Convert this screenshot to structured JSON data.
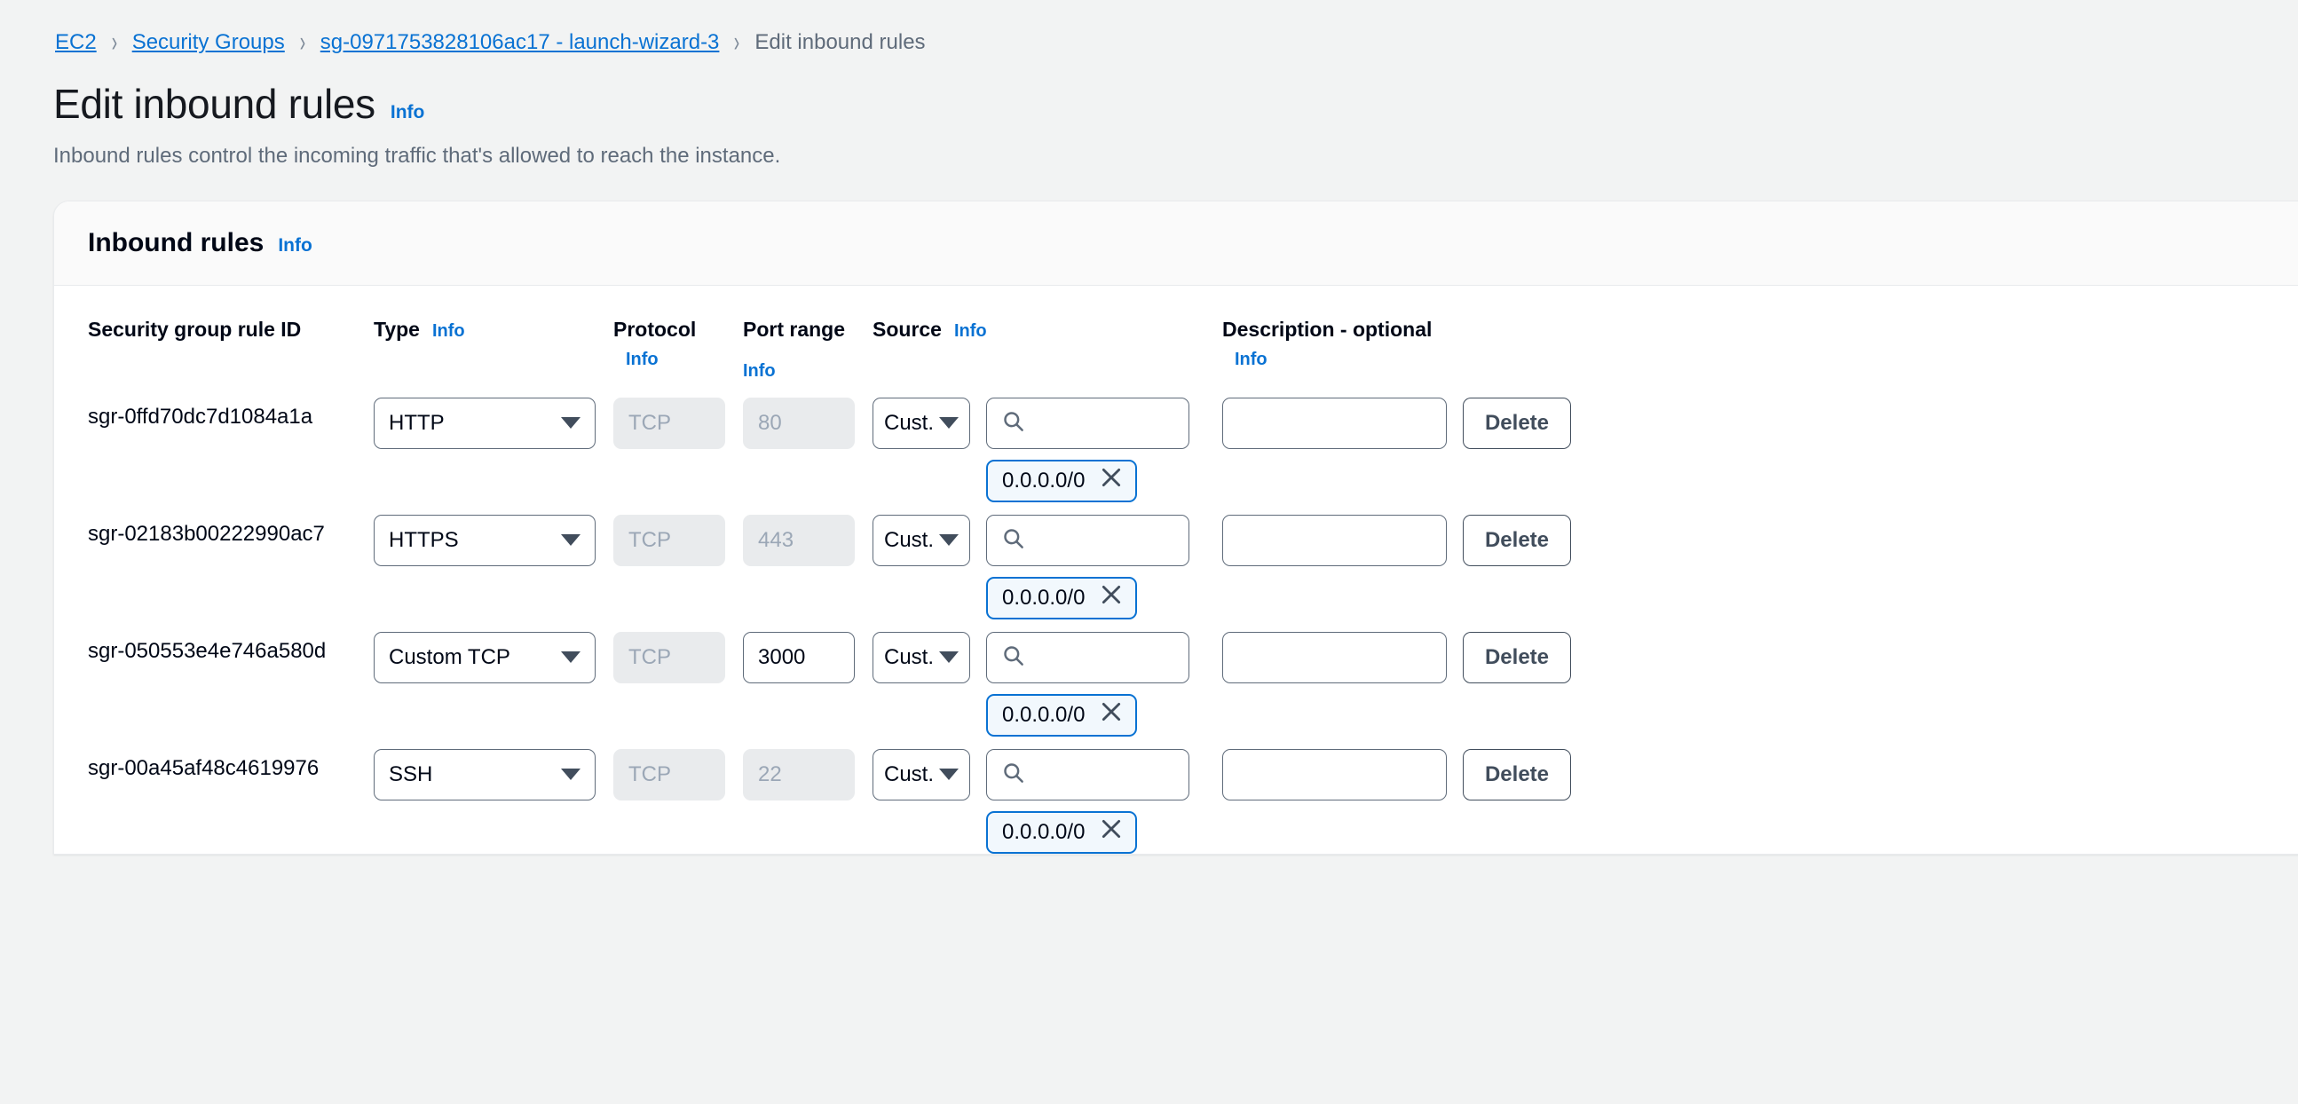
{
  "breadcrumb": {
    "items": [
      {
        "label": "EC2",
        "type": "link"
      },
      {
        "label": "Security Groups",
        "type": "link"
      },
      {
        "label": "sg-0971753828106ac17 - launch-wizard-3",
        "type": "link"
      },
      {
        "label": "Edit inbound rules",
        "type": "current"
      }
    ],
    "separator": "›"
  },
  "page": {
    "title": "Edit inbound rules",
    "info_label": "Info",
    "description": "Inbound rules control the incoming traffic that's allowed to reach the instance."
  },
  "card": {
    "title": "Inbound rules",
    "info_label": "Info"
  },
  "columns": {
    "rule_id": "Security group rule ID",
    "type": "Type",
    "type_info": "Info",
    "protocol": "Protocol",
    "protocol_info": "Info",
    "port_range": "Port range",
    "port_range_info": "Info",
    "source": "Source",
    "source_info": "Info",
    "description": "Description - optional",
    "description_info": "Info"
  },
  "rows": [
    {
      "rule_id": "sgr-0ffd70dc7d1084a1a",
      "type": "HTTP",
      "protocol": "TCP",
      "protocol_disabled": true,
      "port": "80",
      "port_disabled": true,
      "source_type": "Cust...",
      "search_value": "",
      "source_tokens": [
        "0.0.0.0/0"
      ],
      "description": "",
      "delete_label": "Delete"
    },
    {
      "rule_id": "sgr-02183b00222990ac7",
      "type": "HTTPS",
      "protocol": "TCP",
      "protocol_disabled": true,
      "port": "443",
      "port_disabled": true,
      "source_type": "Cust...",
      "search_value": "",
      "source_tokens": [
        "0.0.0.0/0"
      ],
      "description": "",
      "delete_label": "Delete"
    },
    {
      "rule_id": "sgr-050553e4e746a580d",
      "type": "Custom TCP",
      "protocol": "TCP",
      "protocol_disabled": true,
      "port": "3000",
      "port_disabled": false,
      "source_type": "Cust...",
      "search_value": "",
      "source_tokens": [
        "0.0.0.0/0"
      ],
      "description": "",
      "delete_label": "Delete"
    },
    {
      "rule_id": "sgr-00a45af48c4619976",
      "type": "SSH",
      "protocol": "TCP",
      "protocol_disabled": true,
      "port": "22",
      "port_disabled": true,
      "source_type": "Cust...",
      "search_value": "",
      "source_tokens": [
        "0.0.0.0/0"
      ],
      "description": "",
      "delete_label": "Delete"
    }
  ],
  "colors": {
    "link": "#0972d3",
    "page_bg": "#f2f3f3",
    "text": "#000716",
    "muted": "#5f6b7a",
    "token_bg": "#f2f8fd",
    "token_border": "#0972d3",
    "disabled_bg": "#e9ebed"
  },
  "icons": {
    "search": "search-icon",
    "remove": "close-icon",
    "dropdown": "chevron-down-icon"
  }
}
